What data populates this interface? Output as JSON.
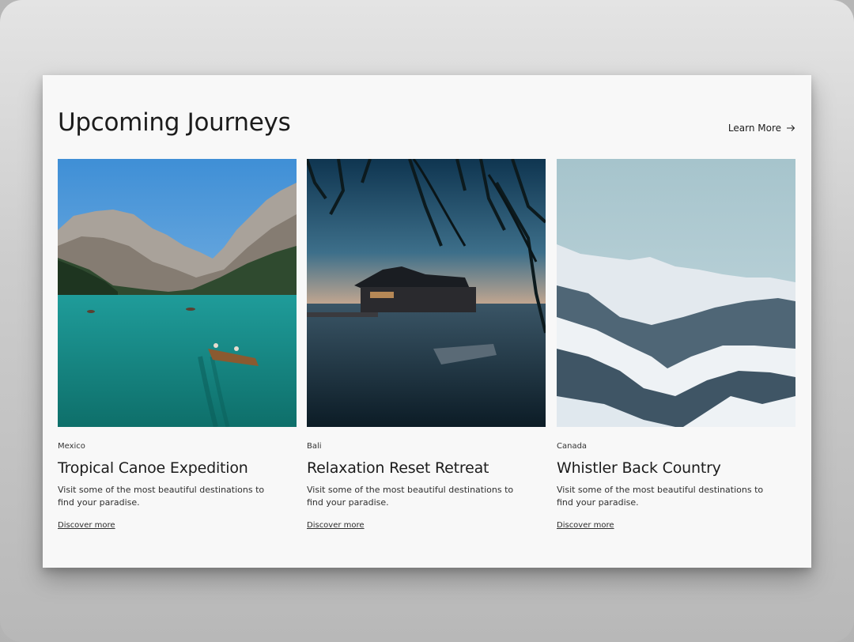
{
  "header": {
    "title": "Upcoming Journeys",
    "learn_more_label": "Learn More",
    "learn_more_icon": "arrow-right-icon"
  },
  "cards": [
    {
      "location": "Mexico",
      "title": "Tropical Canoe Expedition",
      "description": "Visit some of the most beautiful destinations to find your paradise.",
      "link_label": "Discover more"
    },
    {
      "location": "Bali",
      "title": "Relaxation Reset Retreat",
      "description": "Visit some of the most beautiful destinations to find your paradise.",
      "link_label": "Discover more"
    },
    {
      "location": "Canada",
      "title": "Whistler Back Country",
      "description": "Visit some of the most beautiful destinations to find your paradise.",
      "link_label": "Discover more"
    }
  ],
  "colors": {
    "card_background": "#f8f8f8",
    "text": "#1c1c1c"
  }
}
